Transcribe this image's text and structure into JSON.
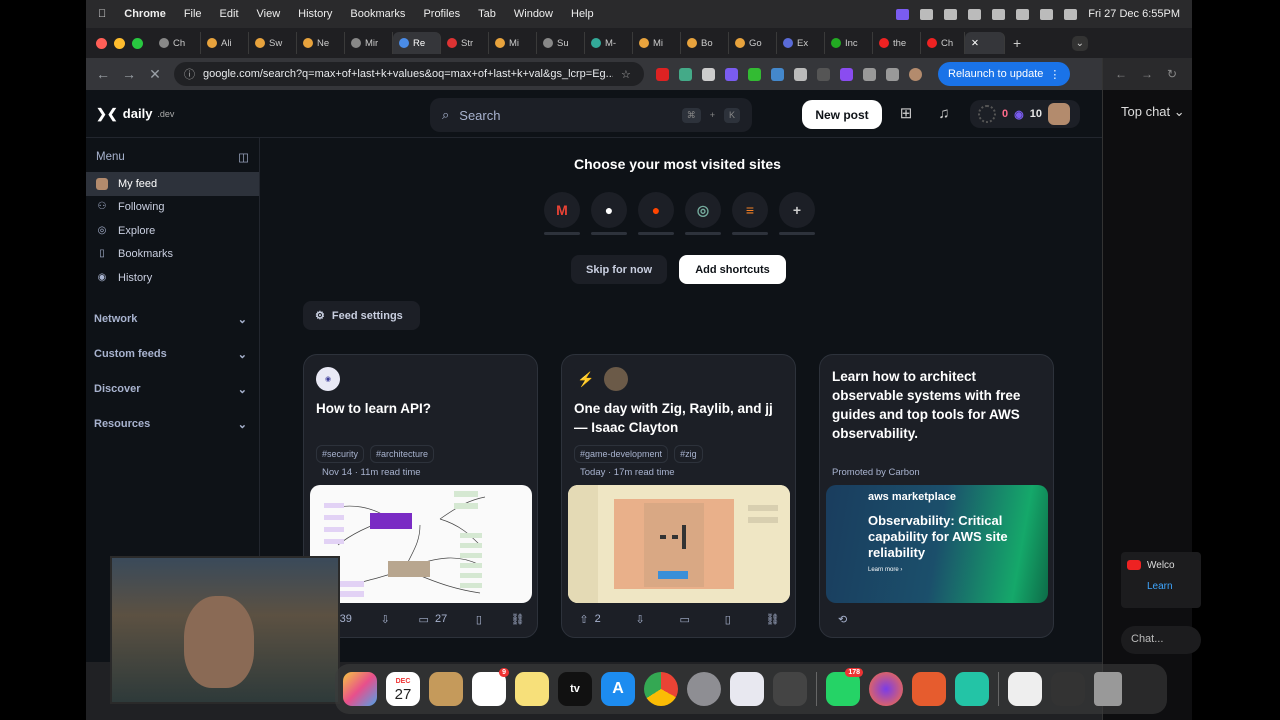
{
  "menubar": {
    "app": "Chrome",
    "items": [
      "File",
      "Edit",
      "View",
      "History",
      "Bookmarks",
      "Profiles",
      "Tab",
      "Window",
      "Help"
    ],
    "clock": "Fri 27 Dec  6:55PM"
  },
  "tabs": [
    "Ch",
    "Ali",
    "Sw",
    "Ne",
    "Mir",
    "Re",
    "Str",
    "Mi",
    "Su",
    "M-",
    "Mi",
    "Bo",
    "Go",
    "Ex",
    "Inc",
    "the",
    "Ch"
  ],
  "urlbar": {
    "url": "google.com/search?q=max+of+last+k+values&oq=max+of+last+k+val&gs_lcrp=Eg...",
    "relaunch": "Relaunch to update"
  },
  "right_panel": {
    "title": "Top chat",
    "welcome": "Welco",
    "learn": "Learn",
    "chat_placeholder": "Chat..."
  },
  "header": {
    "logo": "daily",
    "logo_suffix": ".dev",
    "search_placeholder": "Search",
    "kbd": [
      "⌘",
      "+",
      "K"
    ],
    "new_post": "New post",
    "reputation": "0",
    "streak": "10"
  },
  "sidebar": {
    "title": "Menu",
    "items": [
      {
        "label": "My feed",
        "icon": "avatar-icon"
      },
      {
        "label": "Following",
        "icon": "users-icon"
      },
      {
        "label": "Explore",
        "icon": "compass-icon"
      },
      {
        "label": "Bookmarks",
        "icon": "bookmark-icon"
      },
      {
        "label": "History",
        "icon": "eye-icon"
      }
    ],
    "sections": [
      "Network",
      "Custom feeds",
      "Discover",
      "Resources"
    ]
  },
  "shortcuts": {
    "title": "Choose your most visited sites",
    "skip": "Skip for now",
    "add": "Add shortcuts"
  },
  "feed_settings": "Feed settings",
  "cards": [
    {
      "title": "How to learn API?",
      "tags": [
        "#security",
        "#architecture"
      ],
      "meta": "Nov 14 · 11m read time",
      "upvotes": "339",
      "comments": "27"
    },
    {
      "title": "One day with Zig, Raylib, and jj — Isaac Clayton",
      "tags": [
        "#game-development",
        "#zig"
      ],
      "meta": "Today · 17m read time",
      "upvotes": "2",
      "comments": ""
    },
    {
      "title": "Learn how to architect observable systems with free guides and top tools for AWS observability.",
      "promoted": "Promoted by Carbon",
      "ad_brand": "aws marketplace",
      "ad_title": "Observability: Critical capability for AWS site reliability",
      "ad_cta": "Learn more ›"
    }
  ],
  "dock": {
    "calendar_month": "DEC",
    "calendar_day": "27",
    "reminders_badge": "9",
    "whatsapp_badge": "178",
    "tv_label": "tv"
  },
  "colors": {
    "accent_blue": "#1a73e8",
    "bg": "#0e1217",
    "card": "#1c1f26"
  }
}
